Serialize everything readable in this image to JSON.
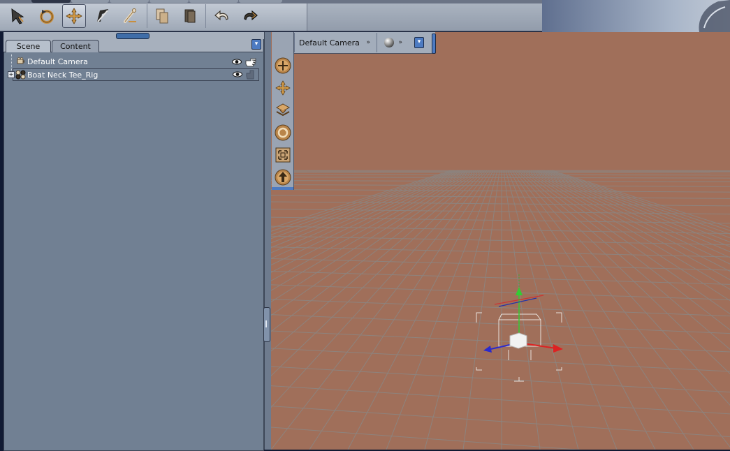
{
  "toolbar": {
    "tools": [
      {
        "name": "select",
        "icon": "select-arrow-icon",
        "active": false
      },
      {
        "name": "rotate",
        "icon": "rotate-icon",
        "active": false
      },
      {
        "name": "translate",
        "icon": "translate-cross-icon",
        "active": true
      },
      {
        "name": "scale",
        "icon": "scale-icon",
        "active": false
      },
      {
        "name": "bone",
        "icon": "bone-tool-icon",
        "active": false
      },
      {
        "name": "copy",
        "icon": "copy-icon",
        "active": false
      },
      {
        "name": "paste",
        "icon": "paste-icon",
        "active": false
      },
      {
        "name": "undo",
        "icon": "undo-arrow-icon",
        "active": false
      },
      {
        "name": "redo",
        "icon": "redo-arrow-icon",
        "active": false
      }
    ]
  },
  "scene_panel": {
    "tabs": [
      {
        "label": "Scene",
        "active": true
      },
      {
        "label": "Content",
        "active": false
      }
    ],
    "items": [
      {
        "label": "Default Camera",
        "icon": "camera-icon",
        "visible": true,
        "selectable": true
      },
      {
        "label": "Boat Neck Tee_Rig",
        "icon": "figure-rig-icon",
        "visible": true,
        "selectable": false
      }
    ]
  },
  "viewport": {
    "camera_label": "Default Camera",
    "background_color": "#a06f5a",
    "camera_controls": [
      "orbit-icon",
      "pan-icon",
      "dolly-icon",
      "roll-icon",
      "frame-icon",
      "up-icon"
    ]
  }
}
